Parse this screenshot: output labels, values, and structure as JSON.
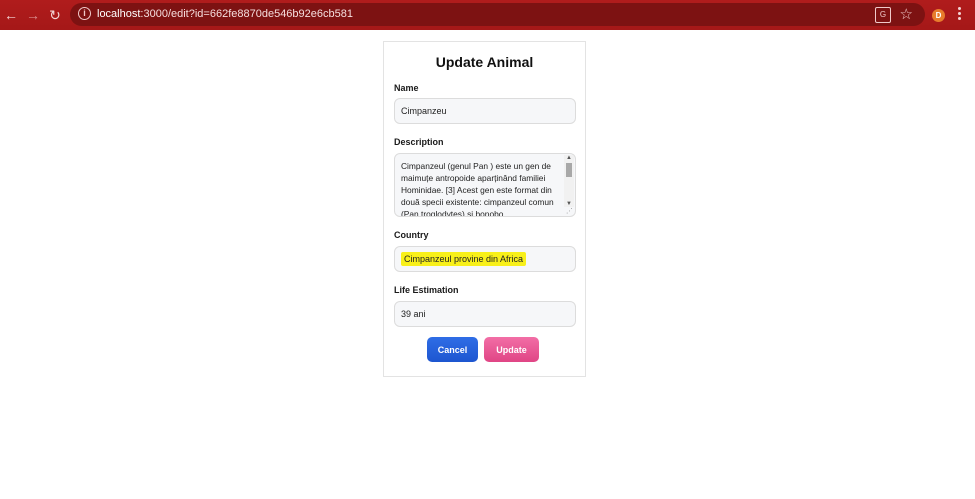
{
  "browser": {
    "url_prefix": "localhost",
    "url_rest": ":3000/edit?id=662fe8870de546b92e6cb581",
    "profile_initial": "D"
  },
  "form": {
    "title": "Update Animal",
    "name_label": "Name",
    "name_value": "Cimpanzeu",
    "description_label": "Description",
    "description_value": "Cimpanzeul (genul Pan ) este un gen de maimuțe antropoide aparținând familiei Hominidae. [3] Acest gen este format din două specii existente: cimpanzeul comun (Pan troglodytes) și bonobo",
    "country_label": "Country",
    "country_value": "Cimpanzeul provine din Africa",
    "life_label": "Life Estimation",
    "life_value": "39 ani",
    "cancel_label": "Cancel",
    "update_label": "Update"
  },
  "colors": {
    "browser_bar": "#a51818",
    "cancel_button": "#1d56d0",
    "update_button": "#e04585",
    "highlight": "#f8f01a"
  }
}
